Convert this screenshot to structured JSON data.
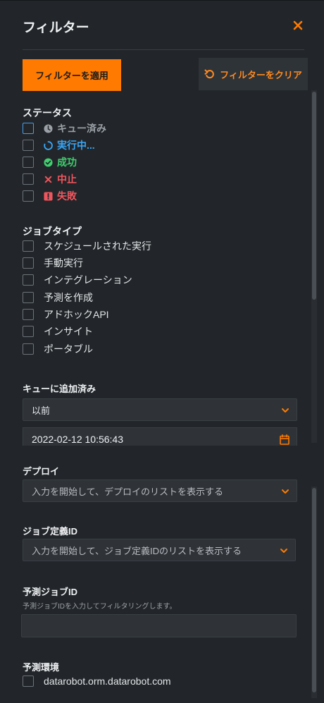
{
  "panel": {
    "title": "フィルター"
  },
  "actions": {
    "apply_label": "フィルターを適用",
    "clear_label": "フィルターをクリア"
  },
  "status": {
    "heading": "ステータス",
    "items": [
      {
        "label": "キュー済み",
        "icon": "clock-icon",
        "color": "#9aa0a6"
      },
      {
        "label": "実行中...",
        "icon": "spinner-icon",
        "color": "#39a6f5"
      },
      {
        "label": "成功",
        "icon": "check-circle-icon",
        "color": "#3fcf6e"
      },
      {
        "label": "中止",
        "icon": "x-icon",
        "color": "#f0555d"
      },
      {
        "label": "失敗",
        "icon": "alert-square-icon",
        "color": "#f0555d"
      }
    ]
  },
  "job_type": {
    "heading": "ジョブタイプ",
    "items": [
      "スケジュールされた実行",
      "手動実行",
      "インテグレーション",
      "予測を作成",
      "アドホックAPI",
      "インサイト",
      "ポータブル"
    ]
  },
  "queued": {
    "heading": "キューに追加済み",
    "select_value": "以前",
    "datetime": "2022-02-12 10:56:43"
  },
  "deploy": {
    "heading": "デプロイ",
    "placeholder": "入力を開始して、デプロイのリストを表示する"
  },
  "job_def": {
    "heading": "ジョブ定義ID",
    "placeholder": "入力を開始して、ジョブ定義IDのリストを表示する"
  },
  "pred_job": {
    "heading": "予測ジョブID",
    "hint": "予測ジョブIDを入力してフィルタリングします。",
    "value": ""
  },
  "env": {
    "heading": "予測環境",
    "items": [
      "datarobot.orm.datarobot.com"
    ]
  },
  "colors": {
    "accent": "#ff7a00",
    "panel_bg": "#22262a",
    "field_bg": "#2f3338"
  }
}
